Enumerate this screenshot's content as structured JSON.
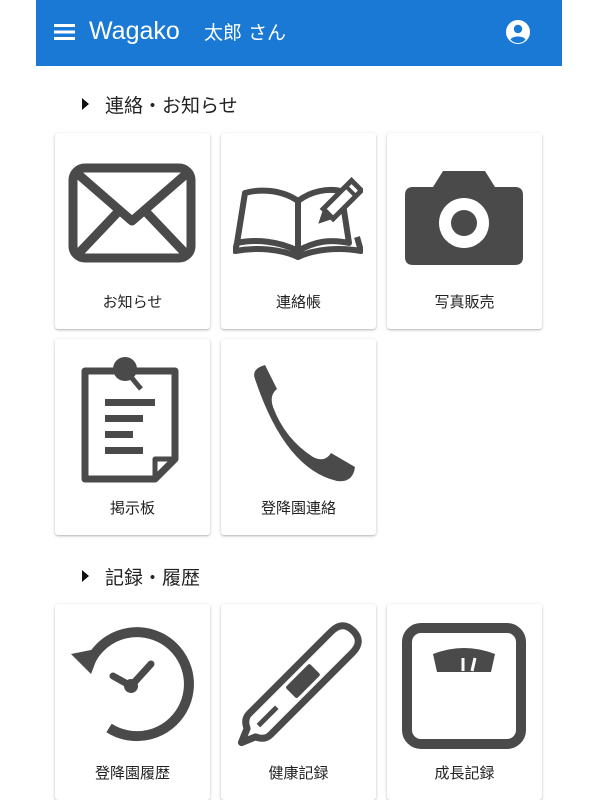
{
  "header": {
    "app_title": "Wagako",
    "user_name": "太郎 さん"
  },
  "sections": [
    {
      "title": "連絡・お知らせ",
      "tiles": [
        {
          "label": "お知らせ",
          "icon": "envelope-icon"
        },
        {
          "label": "連絡帳",
          "icon": "notebook-pencil-icon"
        },
        {
          "label": "写真販売",
          "icon": "camera-icon"
        },
        {
          "label": "掲示板",
          "icon": "bulletin-board-icon"
        },
        {
          "label": "登降園連絡",
          "icon": "phone-icon"
        }
      ]
    },
    {
      "title": "記録・履歴",
      "tiles": [
        {
          "label": "登降園履歴",
          "icon": "history-clock-icon"
        },
        {
          "label": "健康記録",
          "icon": "thermometer-icon"
        },
        {
          "label": "成長記録",
          "icon": "scale-icon"
        }
      ]
    }
  ],
  "colors": {
    "header_bg": "#1b79d6",
    "icon": "#4a4a4a"
  }
}
